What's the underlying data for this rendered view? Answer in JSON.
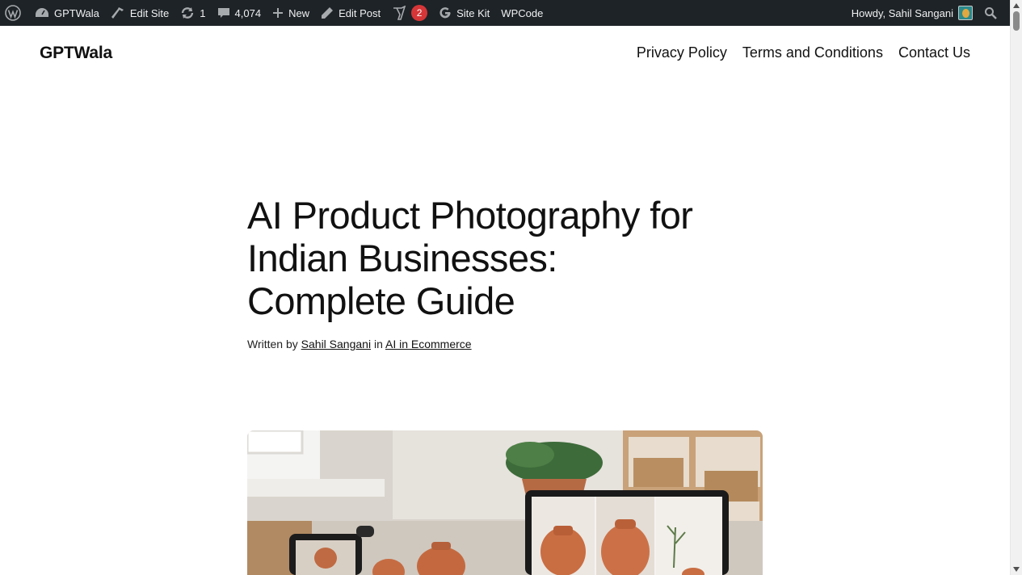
{
  "adminbar": {
    "site_name": "GPTWala",
    "edit_site": "Edit Site",
    "updates_count": "1",
    "comments_count": "4,074",
    "new_label": "New",
    "edit_post": "Edit Post",
    "yoast_badge": "2",
    "site_kit": "Site Kit",
    "wpcode": "WPCode",
    "howdy": "Howdy, Sahil Sangani"
  },
  "header": {
    "site_title": "GPTWala",
    "nav": [
      "Privacy Policy",
      "Terms and Conditions",
      "Contact Us"
    ]
  },
  "post": {
    "title": "AI Product Photography for Indian Businesses: Complete Guide",
    "written_by": "Written by",
    "author": "Sahil Sangani",
    "in_word": "in",
    "category": "AI in Ecommerce"
  },
  "colors": {
    "adminbar_bg": "#1d2327",
    "badge": "#d63638",
    "text": "#111111"
  }
}
